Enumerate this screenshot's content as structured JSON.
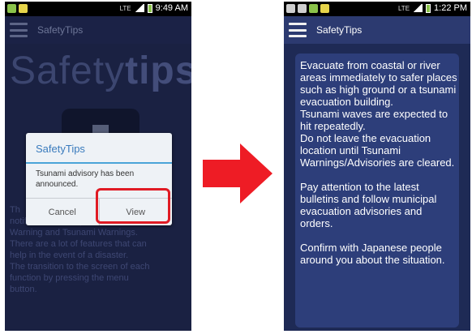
{
  "left_screen": {
    "status": {
      "time": "9:49 AM",
      "network": "LTE"
    },
    "app_title": "SafetyTips",
    "heading_light": "Safety",
    "heading_bold": "tips",
    "description_lines": [
      "The app notifies the Earthquake and",
      "notifies the Earthquake and",
      "Warning and Tsunami Warnings.",
      "There are a lot of features that can",
      "help in the event of a disaster.",
      "The transition to the screen of each",
      "function by pressing the menu",
      "button."
    ],
    "description_text": "Th\nnotifies the Earthquake and\nWarning and Tsunami Warnings.\nThere are a lot of features that can\nhelp in the event of a disaster.\nThe transition to the screen of each\nfunction by pressing the menu\nbutton.",
    "dialog": {
      "title": "SafetyTips",
      "message": "Tsunami advisory has been announced.",
      "cancel_label": "Cancel",
      "view_label": "View"
    }
  },
  "right_screen": {
    "status": {
      "time": "1:22 PM",
      "network": "LTE"
    },
    "app_title": "SafetyTips",
    "paragraphs": [
      "Evacuate from coastal or river areas immediately to safer places such as high ground or a tsunami evacuation building.\nTsunami waves are expected to hit repeatedly.\nDo not leave the evacuation location until Tsunami Warnings/Advisories are cleared.",
      "Pay attention to the latest bulletins and follow municipal evacuation advisories and orders.",
      "Confirm with Japanese people around you about the situation."
    ]
  },
  "colors": {
    "highlight": "#e01b24",
    "arrow": "#ee1c25",
    "accent": "#3a7bbd"
  },
  "icons": [
    "menu-icon",
    "arrow-right-icon",
    "app-icon"
  ]
}
